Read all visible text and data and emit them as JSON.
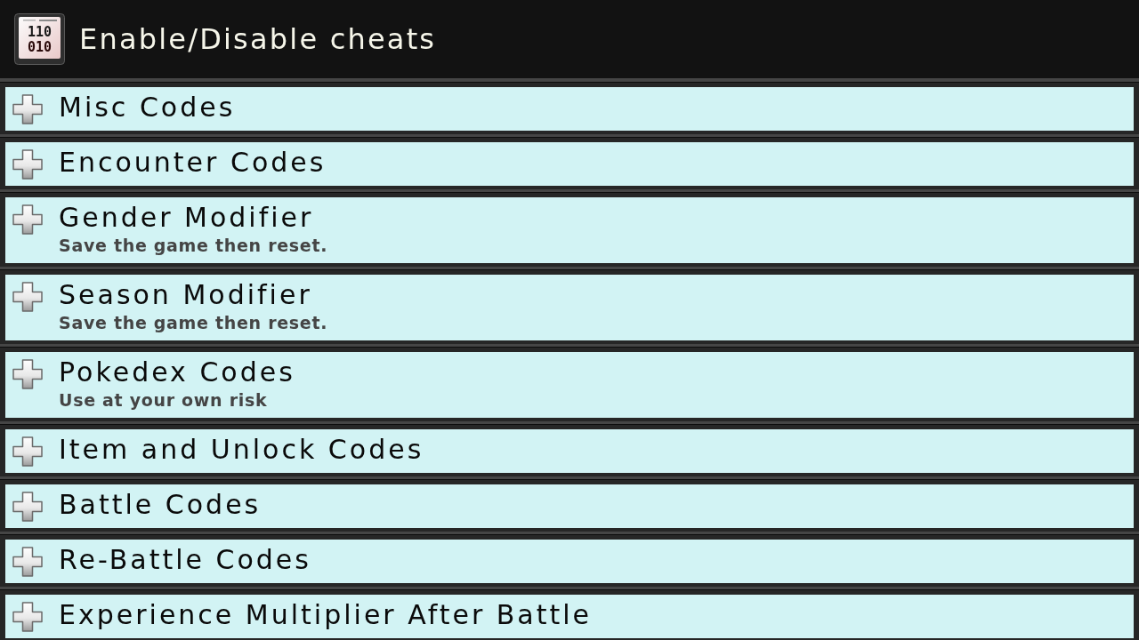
{
  "header": {
    "title": "Enable/Disable cheats",
    "icon_digits": [
      "110",
      "010"
    ]
  },
  "groups": [
    {
      "title": "Misc Codes",
      "expanded": false
    },
    {
      "title": "Encounter Codes",
      "expanded": false
    },
    {
      "title": "Gender Modifier",
      "subtitle": "Save the game then reset.",
      "expanded": false
    },
    {
      "title": "Season Modifier",
      "subtitle": "Save the game then reset.",
      "expanded": false
    },
    {
      "title": "Pokedex Codes",
      "subtitle": "Use at your own risk",
      "expanded": false
    },
    {
      "title": "Item and Unlock Codes",
      "expanded": false
    },
    {
      "title": "Battle Codes",
      "expanded": false
    },
    {
      "title": "Re-Battle Codes",
      "expanded": false
    },
    {
      "title": "Experience Multiplier After Battle",
      "expanded": false
    }
  ]
}
